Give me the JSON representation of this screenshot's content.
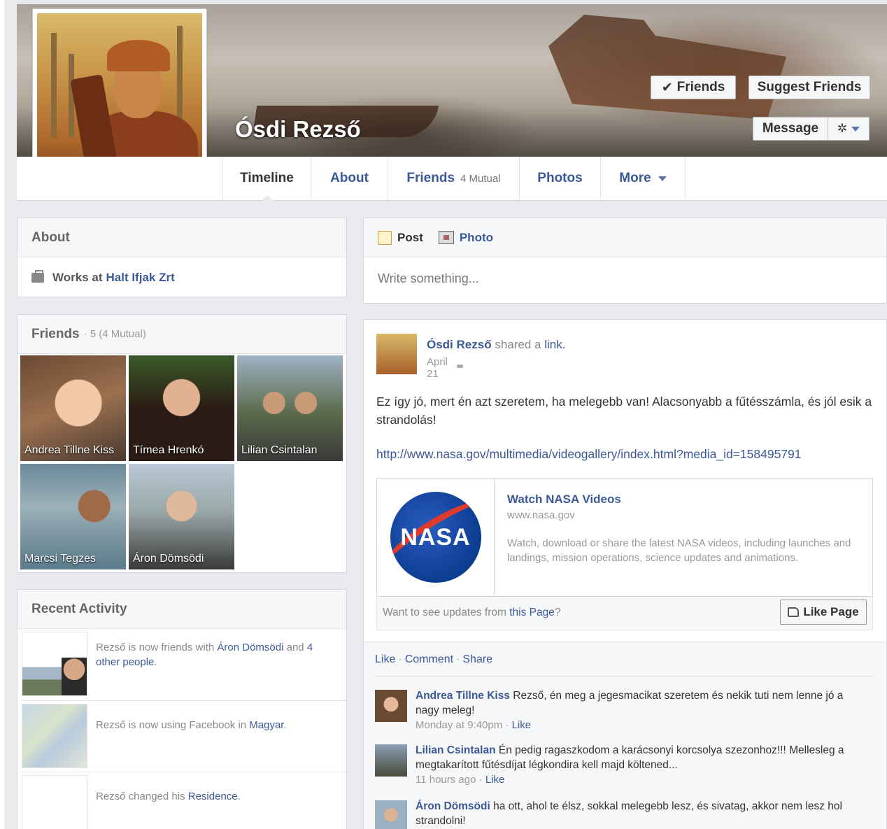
{
  "profile": {
    "name": "Ósdi Rezső",
    "buttons": {
      "friends": "Friends",
      "suggest": "Suggest Friends",
      "message": "Message"
    }
  },
  "tabs": [
    {
      "label": "Timeline"
    },
    {
      "label": "About"
    },
    {
      "label": "Friends",
      "sub": "4 Mutual"
    },
    {
      "label": "Photos"
    },
    {
      "label": "More"
    }
  ],
  "about": {
    "title": "About",
    "works_prefix": "Works at ",
    "works_company": "Halt Ifjak Zrt"
  },
  "friends": {
    "title": "Friends",
    "count": "· 5 (4 Mutual)",
    "list": [
      "Andrea Tillne Kiss",
      "Tímea Hrenkó",
      "Lilian Csintalan",
      "Marcsi Tegzes",
      "Áron Dömsödi"
    ]
  },
  "activity": {
    "title": "Recent Activity",
    "items": [
      {
        "pre": "Rezső is now friends with ",
        "link1": "Áron Dömsödi",
        "mid": " and ",
        "link2": "4 other people",
        "post": "."
      },
      {
        "pre": "Rezső is now using Facebook in ",
        "link1": "Magyar",
        "post": "."
      },
      {
        "pre": "Rezső changed his ",
        "link1": "Residence",
        "post": "."
      }
    ]
  },
  "composer": {
    "post_tab": "Post",
    "photo_tab": "Photo",
    "placeholder": "Write something..."
  },
  "post": {
    "author": "Ósdi Rezső",
    "action": " shared a ",
    "action_link": "link.",
    "date": "April 21",
    "body": "Ez így jó, mert én azt szeretem, ha melegebb van! Alacsonyabb a fűtésszámla, és jól esik a strandolás!",
    "url": "http://www.nasa.gov/multimedia/videogallery/index.html?media_id=158495791",
    "share": {
      "logo_text": "NASA",
      "title": "Watch NASA Videos",
      "domain": "www.nasa.gov",
      "desc": "Watch, download or share the latest NASA videos, including launches and landings, mission operations, science updates and animations."
    },
    "like_strip": {
      "pre": "Want to see updates from ",
      "link": "this Page",
      "post": "?",
      "button": "Like Page"
    },
    "actions": {
      "like": "Like",
      "comment": "Comment",
      "share": "Share"
    },
    "comments": [
      {
        "author": "Andrea Tillne Kiss",
        "text": "Rezső, én meg a jegesmacikat szeretem és nekik tuti nem lenne jó a nagy meleg!",
        "time": "Monday at 9:40pm",
        "like": "Like"
      },
      {
        "author": "Lilian Csintalan",
        "text": "Én pedig ragaszkodom a karácsonyi korcsolya szezonhoz!!! Mellesleg a megtakarított fűtésdíjat légkondira kell majd költened...",
        "time": "11 hours ago",
        "like": "Like"
      },
      {
        "author": "Áron Dömsödi",
        "text": "ha ott, ahol te élsz, sokkal melegebb lesz, és sivatag, akkor nem lesz hol strandolni!"
      }
    ]
  },
  "colors": {
    "link": "#3b5998",
    "background": "#e9eaed"
  }
}
